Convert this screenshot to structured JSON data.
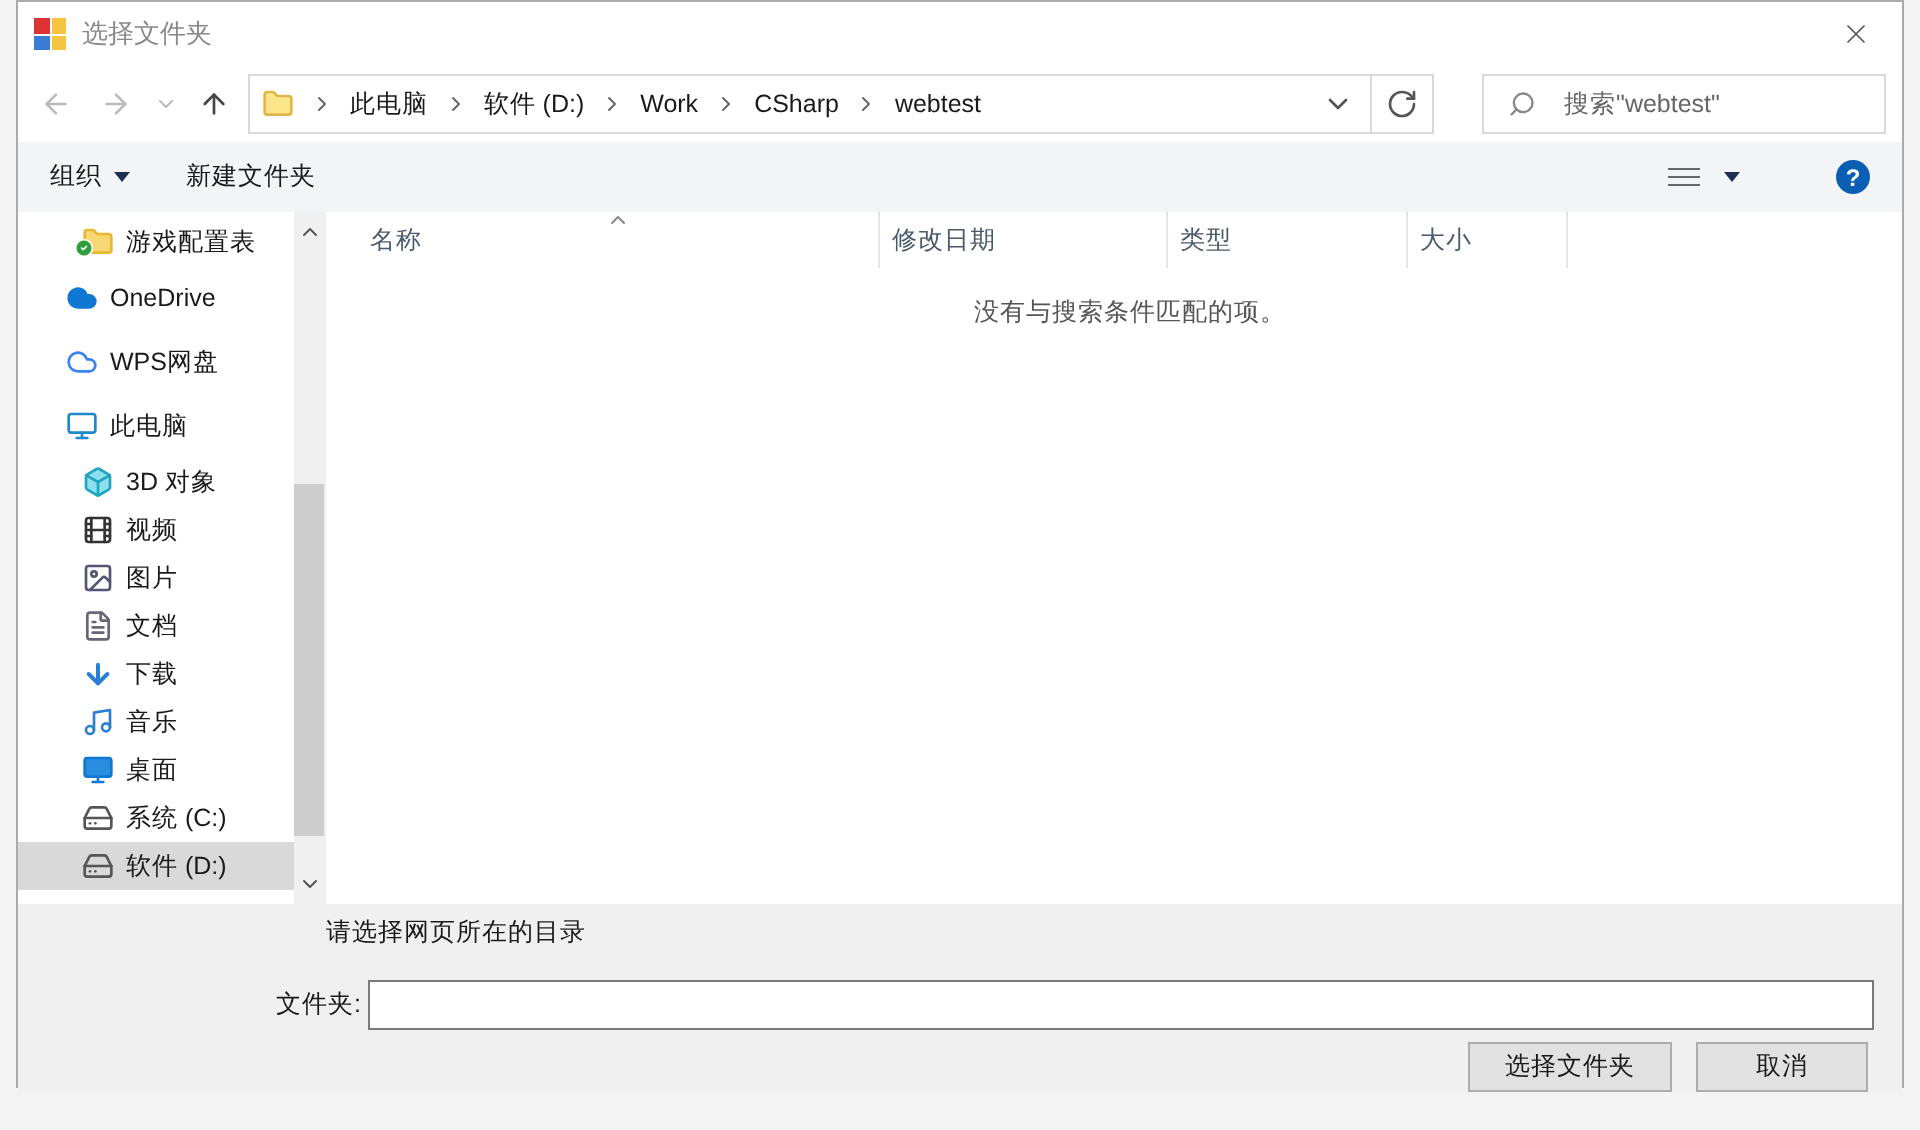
{
  "window": {
    "title": "选择文件夹"
  },
  "address": {
    "crumbs": [
      "此电脑",
      "软件 (D:)",
      "Work",
      "CSharp",
      "webtest"
    ]
  },
  "search": {
    "placeholder": "搜索\"webtest\""
  },
  "toolbar": {
    "organize": "组织",
    "new_folder": "新建文件夹",
    "help": "?"
  },
  "sidebar": {
    "items": [
      {
        "label": "游戏配置表",
        "kind": "synced-folder",
        "indent": true,
        "selected": false
      },
      {
        "label": "OneDrive",
        "kind": "cloud",
        "indent": false,
        "selected": false
      },
      {
        "label": "WPS网盘",
        "kind": "cloud-outline",
        "indent": false,
        "selected": false
      },
      {
        "label": "此电脑",
        "kind": "computer",
        "indent": false,
        "selected": false
      },
      {
        "label": "3D 对象",
        "kind": "cube",
        "indent": true,
        "selected": false
      },
      {
        "label": "视频",
        "kind": "film",
        "indent": true,
        "selected": false
      },
      {
        "label": "图片",
        "kind": "image",
        "indent": true,
        "selected": false
      },
      {
        "label": "文档",
        "kind": "document",
        "indent": true,
        "selected": false
      },
      {
        "label": "下载",
        "kind": "download",
        "indent": true,
        "selected": false
      },
      {
        "label": "音乐",
        "kind": "music",
        "indent": true,
        "selected": false
      },
      {
        "label": "桌面",
        "kind": "desktop",
        "indent": true,
        "selected": false
      },
      {
        "label": "系统 (C:)",
        "kind": "drive",
        "indent": true,
        "selected": false
      },
      {
        "label": "软件 (D:)",
        "kind": "drive",
        "indent": true,
        "selected": true
      }
    ]
  },
  "table": {
    "columns": [
      "名称",
      "修改日期",
      "类型",
      "大小"
    ],
    "empty_message": "没有与搜索条件匹配的项。"
  },
  "description": "请选择网页所在的目录",
  "folder_field": {
    "label": "文件夹:"
  },
  "buttons": [
    "选择文件夹",
    "取消"
  ]
}
